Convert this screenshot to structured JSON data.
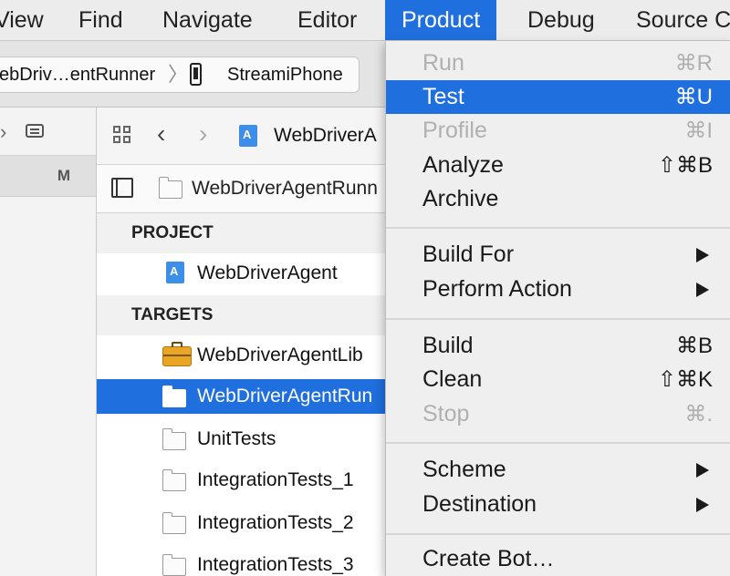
{
  "menubar": {
    "items": [
      "View",
      "Find",
      "Navigate",
      "Editor",
      "Product",
      "Debug",
      "Source C"
    ]
  },
  "toolbar": {
    "scheme": "ebDriv…entRunner",
    "device": "StreamiPhone"
  },
  "navigator": {
    "column_header": "M"
  },
  "editor": {
    "jumpbar_title": "WebDriverA",
    "subbar_title": "WebDriverAgentRunn",
    "project_header": "PROJECT",
    "project_name": "WebDriverAgent",
    "targets_header": "TARGETS",
    "targets": [
      "WebDriverAgentLib",
      "WebDriverAgentRun",
      "UnitTests",
      "IntegrationTests_1",
      "IntegrationTests_2",
      "IntegrationTests_3"
    ],
    "selected_target_index": 1
  },
  "product_menu": {
    "items": [
      {
        "label": "Run",
        "shortcut": "⌘R",
        "state": "disabled"
      },
      {
        "label": "Test",
        "shortcut": "⌘U",
        "state": "highlighted"
      },
      {
        "label": "Profile",
        "shortcut": "⌘I",
        "state": "disabled"
      },
      {
        "label": "Analyze",
        "shortcut": "⇧⌘B",
        "state": "enabled"
      },
      {
        "label": "Archive",
        "shortcut": "",
        "state": "enabled"
      },
      {
        "label": "Build For",
        "submenu": true,
        "state": "enabled"
      },
      {
        "label": "Perform Action",
        "submenu": true,
        "state": "enabled"
      },
      {
        "label": "Build",
        "shortcut": "⌘B",
        "state": "enabled"
      },
      {
        "label": "Clean",
        "shortcut": "⇧⌘K",
        "state": "enabled"
      },
      {
        "label": "Stop",
        "shortcut": "⌘.",
        "state": "disabled"
      },
      {
        "label": "Scheme",
        "submenu": true,
        "state": "enabled"
      },
      {
        "label": "Destination",
        "submenu": true,
        "state": "enabled"
      },
      {
        "label": "Create Bot…",
        "shortcut": "",
        "state": "enabled"
      }
    ]
  },
  "colors": {
    "accent": "#1f6fde",
    "disabled_text": "#b0b0b0",
    "menu_bg": "#efefef"
  },
  "icons": [
    "chevron-right-icon",
    "comment-icon",
    "grid-icon",
    "back-arrow-icon",
    "forward-arrow-icon",
    "project-file-icon",
    "iphone-icon",
    "sidebar-toggle-icon",
    "folder-icon",
    "toolbox-icon",
    "submenu-arrow-icon"
  ]
}
